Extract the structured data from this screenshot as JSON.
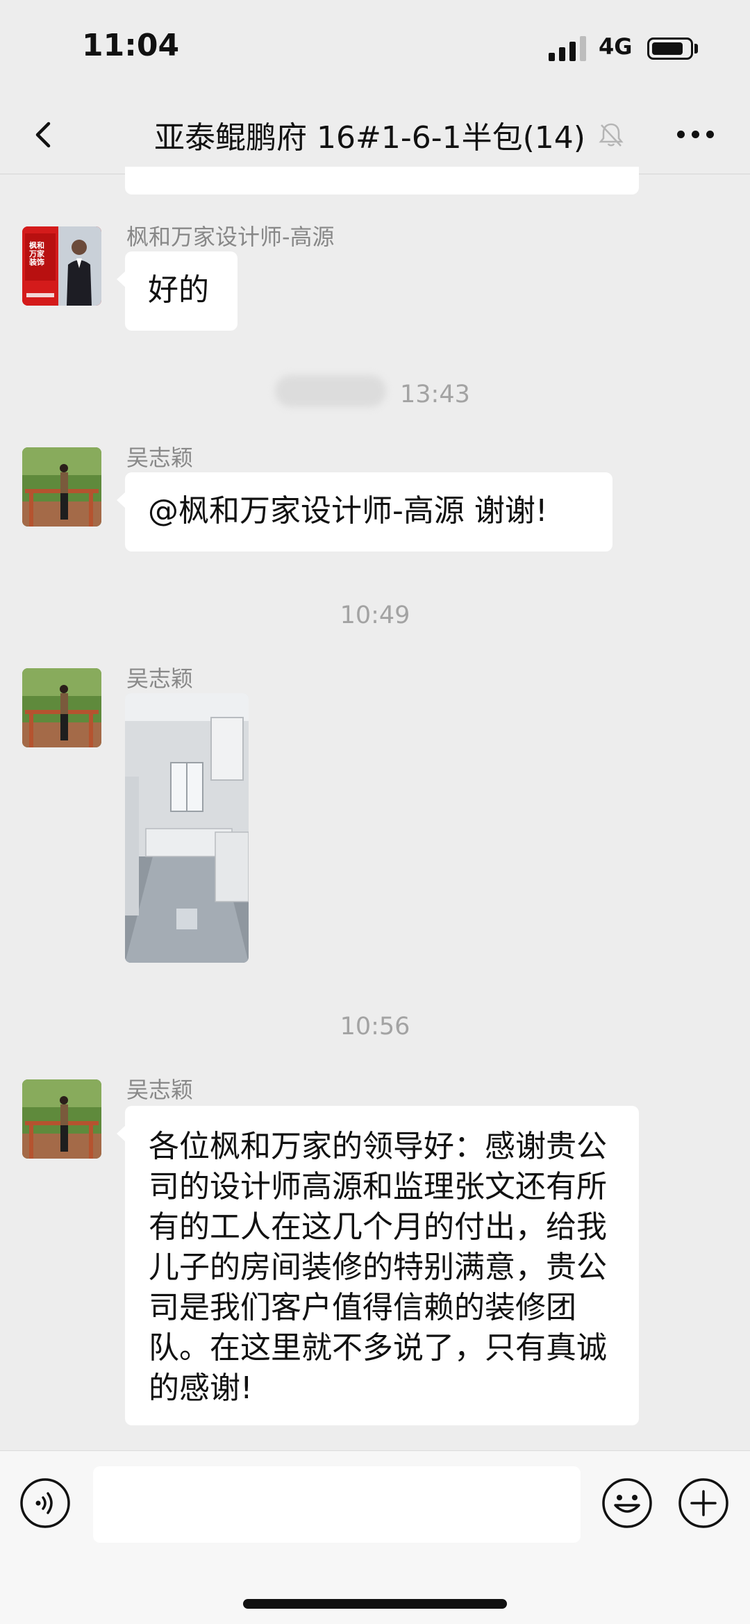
{
  "status_bar": {
    "time": "11:04",
    "network": "4G",
    "signal_bars": 3,
    "signal_bars_max": 4
  },
  "nav": {
    "title": "亚泰鲲鹏府 16#1-6-1半包(14)",
    "back_icon": "chevron-left-icon",
    "mute_icon": "bell-off-icon",
    "more_icon": "more-dots-icon"
  },
  "colors": {
    "background": "#ededed",
    "bubble": "#ffffff",
    "meta_text": "#a3a3a3",
    "sender_text": "#888888",
    "avatar_red": "#d41b1b"
  },
  "messages": [
    {
      "sender": "枫和万家设计师-高源",
      "text": "好的",
      "avatar": "company-avatar"
    },
    {
      "time": "13:43"
    },
    {
      "sender": "吴志颖",
      "text": "@枫和万家设计师-高源 谢谢!",
      "avatar": "user-avatar"
    },
    {
      "time": "10:49"
    },
    {
      "sender": "吴志颖",
      "type": "image",
      "image": "kitchen-photo",
      "avatar": "user-avatar"
    },
    {
      "time": "10:56"
    },
    {
      "sender": "吴志颖",
      "text": "各位枫和万家的领导好：感谢贵公司的设计师高源和监理张文还有所有的工人在这几个月的付出，给我儿子的房间装修的特别满意，贵公司是我们客户值得信赖的装修团队。在这里就不多说了，只有真诚的感谢!",
      "avatar": "user-avatar"
    }
  ],
  "company_avatar_text": "枫和万家装饰",
  "input_bar": {
    "voice_icon": "voice-icon",
    "emoji_icon": "emoji-icon",
    "plus_icon": "plus-icon",
    "input_value": ""
  }
}
